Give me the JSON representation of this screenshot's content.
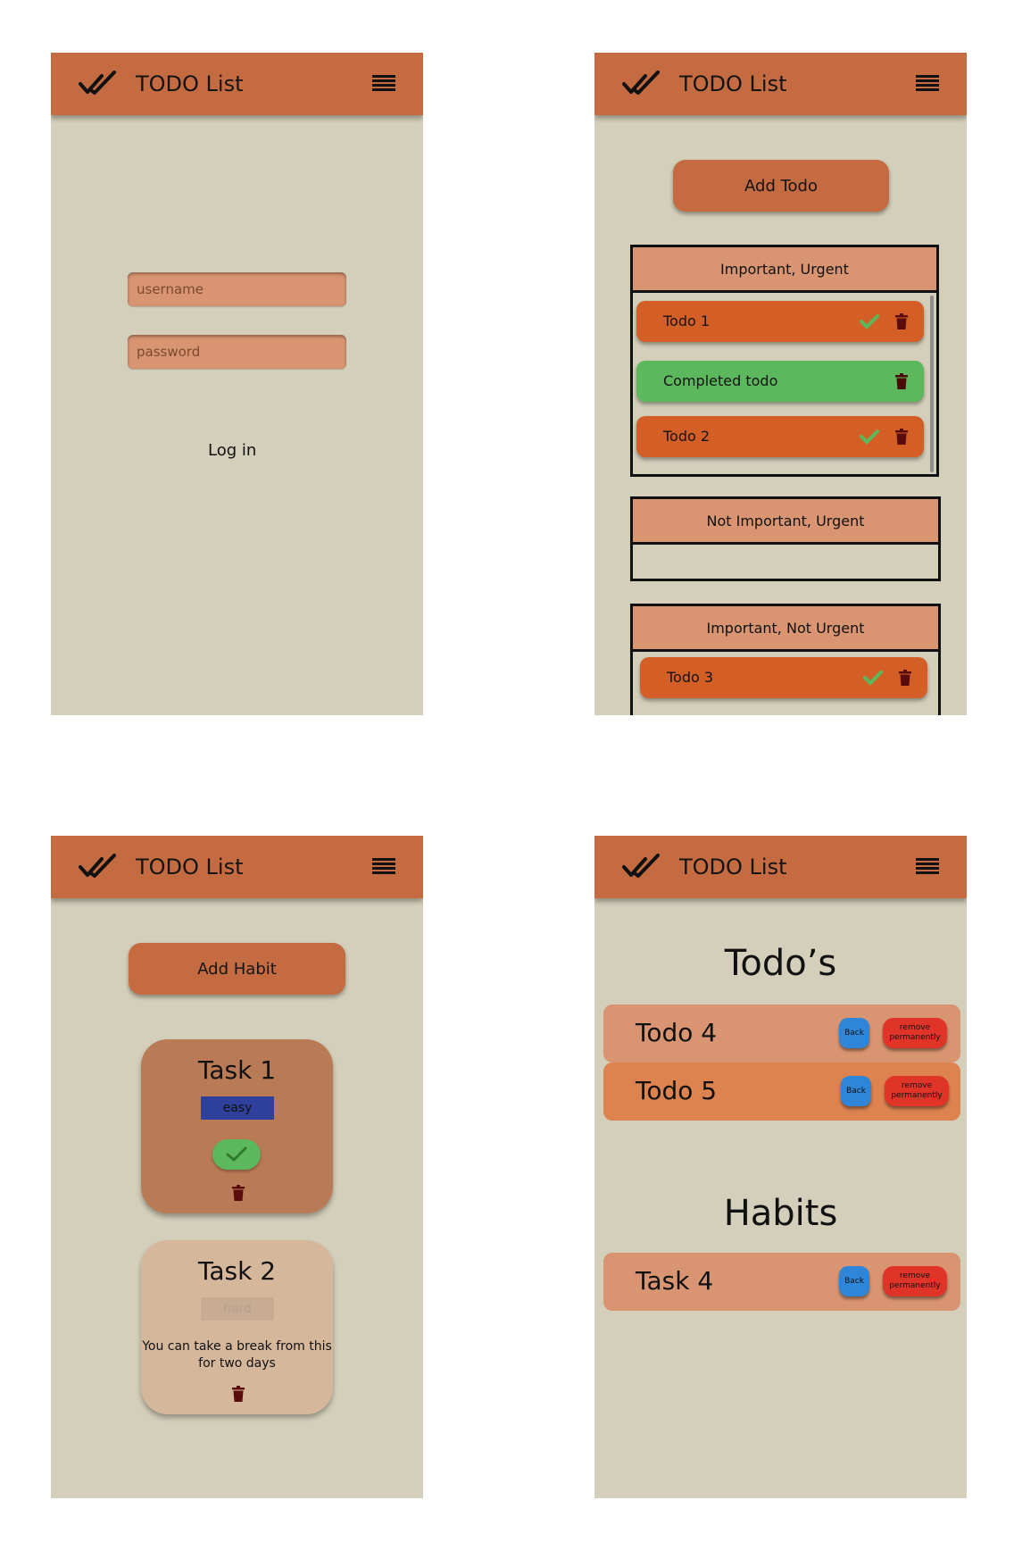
{
  "app": {
    "title": "TODO List",
    "logo_icon": "double-check-icon",
    "menu_icon": "hamburger-menu-icon"
  },
  "login": {
    "username_placeholder": "username",
    "password_placeholder": "password",
    "login_label": "Log in"
  },
  "todos_screen": {
    "add_label": "Add Todo",
    "quadrants": [
      {
        "title": "Important, Urgent",
        "items": [
          {
            "label": "Todo 1",
            "status": "open"
          },
          {
            "label": "Completed todo",
            "status": "completed"
          },
          {
            "label": "Todo 2",
            "status": "open"
          }
        ]
      },
      {
        "title": "Not Important, Urgent",
        "items": []
      },
      {
        "title": "Important, Not Urgent",
        "items": [
          {
            "label": "Todo 3",
            "status": "open"
          }
        ]
      }
    ]
  },
  "habits_screen": {
    "add_label": "Add Habit",
    "habits": [
      {
        "name": "Task 1",
        "difficulty": "easy",
        "state": "active"
      },
      {
        "name": "Task 2",
        "difficulty": "hard",
        "state": "break",
        "note": "You can take a break from this for two days"
      }
    ]
  },
  "archive_screen": {
    "todos_title": "Todo’s",
    "habits_title": "Habits",
    "back_label": "Back",
    "remove_label": "remove permanently",
    "todos": [
      "Todo 4",
      "Todo 5"
    ],
    "habits": [
      "Task 4"
    ]
  },
  "colors": {
    "background": "#d4cfba",
    "appbar": "#c56b41",
    "todo_open": "#d45f26",
    "todo_done": "#5cb85c",
    "header_tan": "#d99571",
    "easy_badge": "#2e3f9c",
    "back_blue": "#2f86d8",
    "remove_red": "#e03429"
  }
}
